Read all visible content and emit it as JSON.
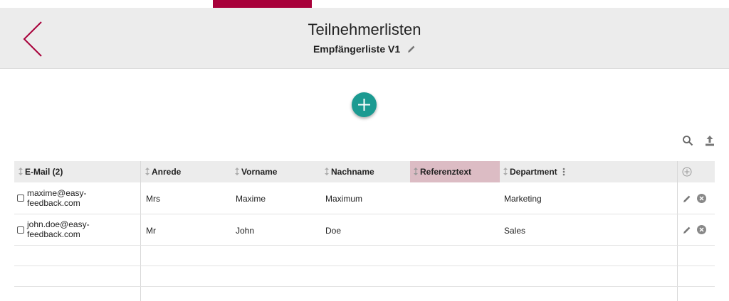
{
  "header": {
    "title": "Teilnehmerlisten",
    "subtitle": "Empfängerliste V1",
    "back_icon": "chevron-left-icon",
    "edit_icon": "pencil-icon"
  },
  "toolbar": {
    "add_icon": "plus-icon",
    "search_icon": "search-icon",
    "upload_icon": "upload-icon"
  },
  "table": {
    "columns": {
      "email": "E-Mail (2)",
      "anrede": "Anrede",
      "vorname": "Vorname",
      "nachname": "Nachname",
      "referenztext": "Referenztext",
      "department": "Department"
    },
    "rows": [
      {
        "email_line1": "maxime@easy-",
        "email_line2": "feedback.com",
        "anrede": "Mrs",
        "vorname": "Maxime",
        "nachname": "Maximum",
        "referenztext": "",
        "department": "Marketing"
      },
      {
        "email_line1": "john.doe@easy-",
        "email_line2": "feedback.com",
        "anrede": "Mr",
        "vorname": "John",
        "nachname": "Doe",
        "referenztext": "",
        "department": "Sales"
      }
    ]
  },
  "colors": {
    "accent": "#a8003a",
    "add_button": "#1b9a91",
    "highlight_column": "#dcbcc4",
    "header_bg": "#ececec"
  }
}
